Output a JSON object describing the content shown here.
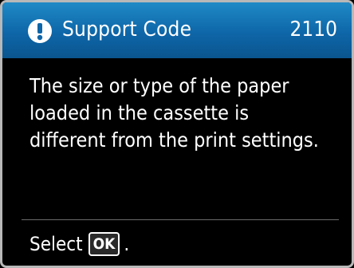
{
  "header": {
    "icon": "exclamation-icon",
    "title": "Support Code",
    "code": "2110",
    "colors": {
      "background": "#0e66a8",
      "text": "#ffffff"
    }
  },
  "message": {
    "lines": [
      "The size or type of the paper",
      "loaded in the cassette is",
      "different from the print settings."
    ]
  },
  "footer": {
    "select_label": "Select",
    "ok_key_label": "OK",
    "trailing": "."
  }
}
